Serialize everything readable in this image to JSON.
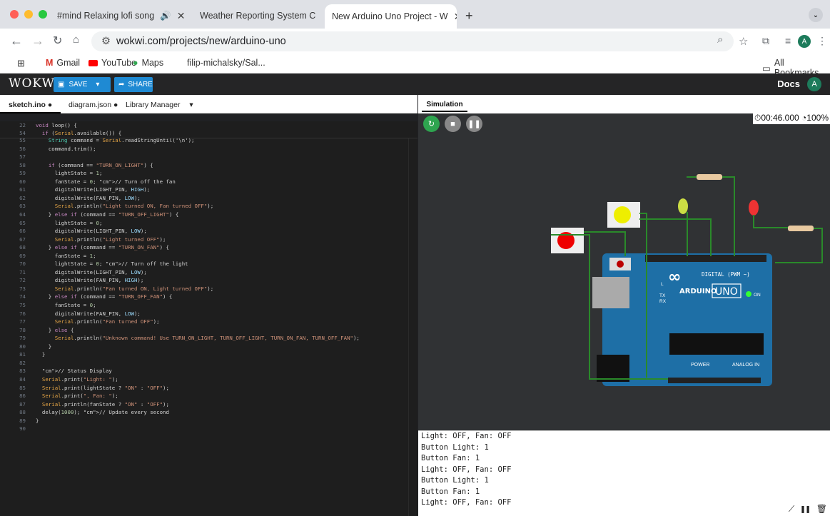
{
  "browser": {
    "tabs": [
      {
        "title": "#mind Relaxing lofi song",
        "icon": "youtube-icon"
      },
      {
        "title": "Weather Reporting System C",
        "icon": "chatgpt-icon"
      },
      {
        "title": "New Arduino Uno Project - W",
        "icon": "wokwi-icon",
        "active": true
      }
    ],
    "url": "wokwi.com/projects/new/arduino-uno",
    "avatar": "A",
    "bookmarks": [
      "Gmail",
      "YouTube",
      "Maps",
      "filip-michalsky/Sal..."
    ],
    "all_bookmarks": "All Bookmarks"
  },
  "wokwi": {
    "logo": "WOKWi",
    "save": "SAVE",
    "share": "SHARE",
    "docs": "Docs",
    "avatar": "A"
  },
  "editor": {
    "tabs": [
      "sketch.ino ●",
      "diagram.json ●",
      "Library Manager"
    ],
    "sticky": [
      {
        "n": "22",
        "t": "void loop() {"
      },
      {
        "n": "54",
        "t": "  if (Serial.available()) {"
      }
    ],
    "lines": [
      {
        "n": "55",
        "t": "    String command = Serial.readStringUntil('\\n');"
      },
      {
        "n": "56",
        "t": "    command.trim();"
      },
      {
        "n": "57",
        "t": ""
      },
      {
        "n": "58",
        "t": "    if (command == \"TURN_ON_LIGHT\") {"
      },
      {
        "n": "59",
        "t": "      lightState = 1;"
      },
      {
        "n": "60",
        "t": "      fanState = 0; // Turn off the fan"
      },
      {
        "n": "61",
        "t": "      digitalWrite(LIGHT_PIN, HIGH);"
      },
      {
        "n": "62",
        "t": "      digitalWrite(FAN_PIN, LOW);"
      },
      {
        "n": "63",
        "t": "      Serial.println(\"Light turned ON, Fan turned OFF\");"
      },
      {
        "n": "64",
        "t": "    } else if (command == \"TURN_OFF_LIGHT\") {"
      },
      {
        "n": "65",
        "t": "      lightState = 0;"
      },
      {
        "n": "66",
        "t": "      digitalWrite(LIGHT_PIN, LOW);"
      },
      {
        "n": "67",
        "t": "      Serial.println(\"Light turned OFF\");"
      },
      {
        "n": "68",
        "t": "    } else if (command == \"TURN_ON_FAN\") {"
      },
      {
        "n": "69",
        "t": "      fanState = 1;"
      },
      {
        "n": "70",
        "t": "      lightState = 0; // Turn off the light"
      },
      {
        "n": "71",
        "t": "      digitalWrite(LIGHT_PIN, LOW);"
      },
      {
        "n": "72",
        "t": "      digitalWrite(FAN_PIN, HIGH);"
      },
      {
        "n": "73",
        "t": "      Serial.println(\"Fan turned ON, Light turned OFF\");"
      },
      {
        "n": "74",
        "t": "    } else if (command == \"TURN_OFF_FAN\") {"
      },
      {
        "n": "75",
        "t": "      fanState = 0;"
      },
      {
        "n": "76",
        "t": "      digitalWrite(FAN_PIN, LOW);"
      },
      {
        "n": "77",
        "t": "      Serial.println(\"Fan turned OFF\");"
      },
      {
        "n": "78",
        "t": "    } else {"
      },
      {
        "n": "79",
        "t": "      Serial.println(\"Unknown command! Use TURN_ON_LIGHT, TURN_OFF_LIGHT, TURN_ON_FAN, TURN_OFF_FAN\");"
      },
      {
        "n": "80",
        "t": "    }"
      },
      {
        "n": "81",
        "t": "  }"
      },
      {
        "n": "82",
        "t": ""
      },
      {
        "n": "83",
        "t": "  // Status Display"
      },
      {
        "n": "84",
        "t": "  Serial.print(\"Light: \");"
      },
      {
        "n": "85",
        "t": "  Serial.print(lightState ? \"ON\" : \"OFF\");"
      },
      {
        "n": "86",
        "t": "  Serial.print(\", Fan: \");"
      },
      {
        "n": "87",
        "t": "  Serial.println(fanState ? \"ON\" : \"OFF\");"
      },
      {
        "n": "88",
        "t": "  delay(1000); // Update every second"
      },
      {
        "n": "89",
        "t": "}"
      },
      {
        "n": "90",
        "t": ""
      }
    ]
  },
  "simulation": {
    "tab": "Simulation",
    "timer": "00:46.000",
    "speed": "100%",
    "board": {
      "brand": "ARDUINO",
      "model": "UNO",
      "digital": "DIGITAL (PWM ~)",
      "power": "POWER",
      "analog": "ANALOG IN",
      "on": "ON",
      "tx": "TX",
      "rx": "RX",
      "l": "L"
    }
  },
  "serial": {
    "lines": [
      "Light: OFF, Fan: OFF",
      "Button Light: 1",
      "Button Fan: 1",
      "Light: OFF, Fan: OFF",
      "Button Light: 1",
      "Button Fan: 1",
      "Light: OFF, Fan: OFF"
    ]
  }
}
